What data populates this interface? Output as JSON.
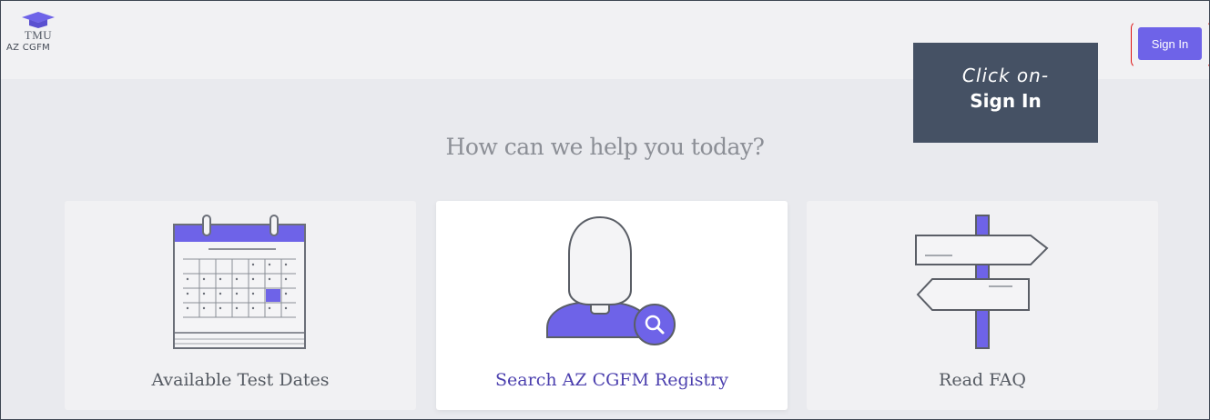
{
  "header": {
    "logo_abbr": "TMU",
    "logo_sub": "AZ CGFM",
    "signin_label": "Sign In"
  },
  "callout": {
    "line1": "Click on-",
    "line2": "Sign In"
  },
  "main": {
    "headline": "How can we help you today?",
    "cards": [
      {
        "label": "Available Test Dates",
        "icon": "calendar-icon"
      },
      {
        "label": "Search AZ CGFM Registry",
        "icon": "person-search-icon"
      },
      {
        "label": "Read FAQ",
        "icon": "signpost-icon"
      }
    ]
  },
  "colors": {
    "accent": "#6e63e8",
    "callout_bg": "#455164",
    "highlight": "#dd1111",
    "page_bg": "#e9eaee"
  }
}
